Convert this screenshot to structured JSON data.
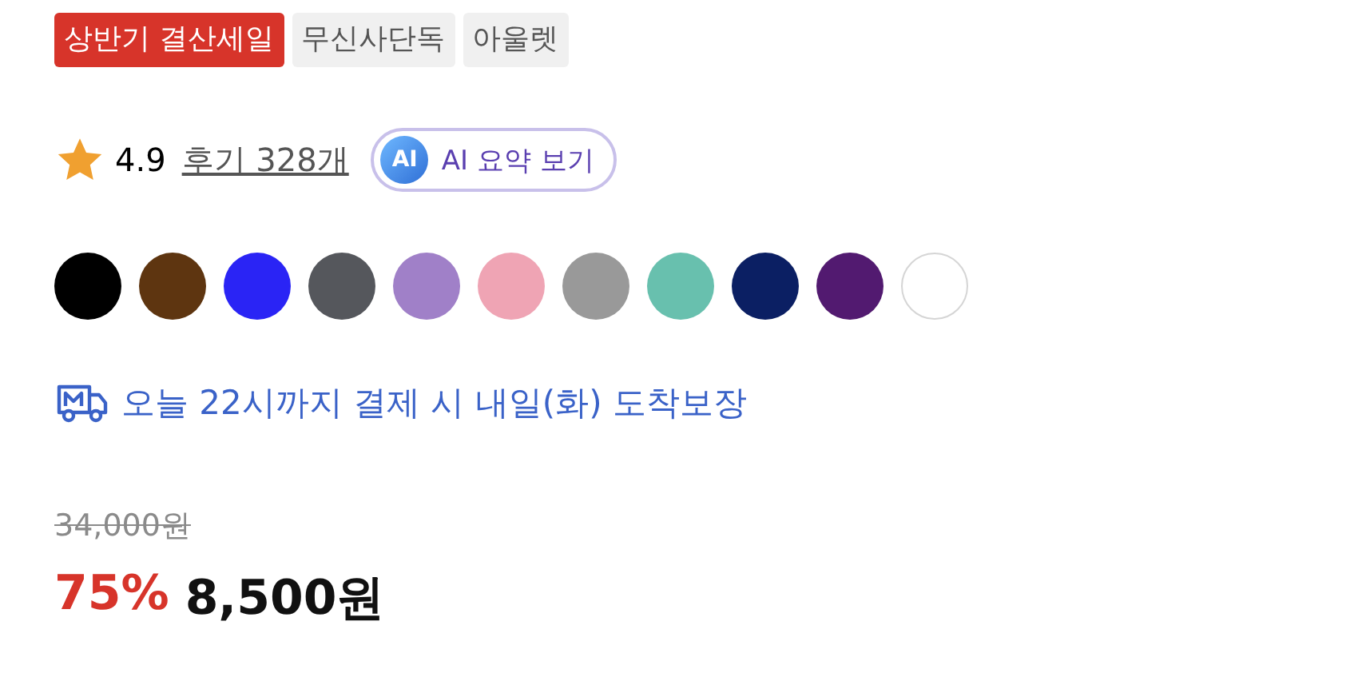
{
  "tags": [
    {
      "label": "상반기 결산세일",
      "kind": "sale"
    },
    {
      "label": "무신사단독",
      "kind": "plain"
    },
    {
      "label": "아울렛",
      "kind": "plain"
    }
  ],
  "rating": {
    "score": "4.9",
    "reviews": "후기 328개"
  },
  "ai_button": {
    "badge": "AI",
    "label": "AI 요약 보기"
  },
  "swatches": [
    {
      "color": "#000000"
    },
    {
      "color": "#5e3510"
    },
    {
      "color": "#2a24f5"
    },
    {
      "color": "#55575c"
    },
    {
      "color": "#a080c8"
    },
    {
      "color": "#efa4b4"
    },
    {
      "color": "#999999"
    },
    {
      "color": "#68c0ae"
    },
    {
      "color": "#0b1f63"
    },
    {
      "color": "#521a70"
    },
    {
      "color": "#ffffff"
    }
  ],
  "delivery": {
    "text": "오늘 22시까지 결제 시 내일(화) 도착보장"
  },
  "price": {
    "original": "34,000원",
    "discount": "75%",
    "sale": "8,500원"
  }
}
